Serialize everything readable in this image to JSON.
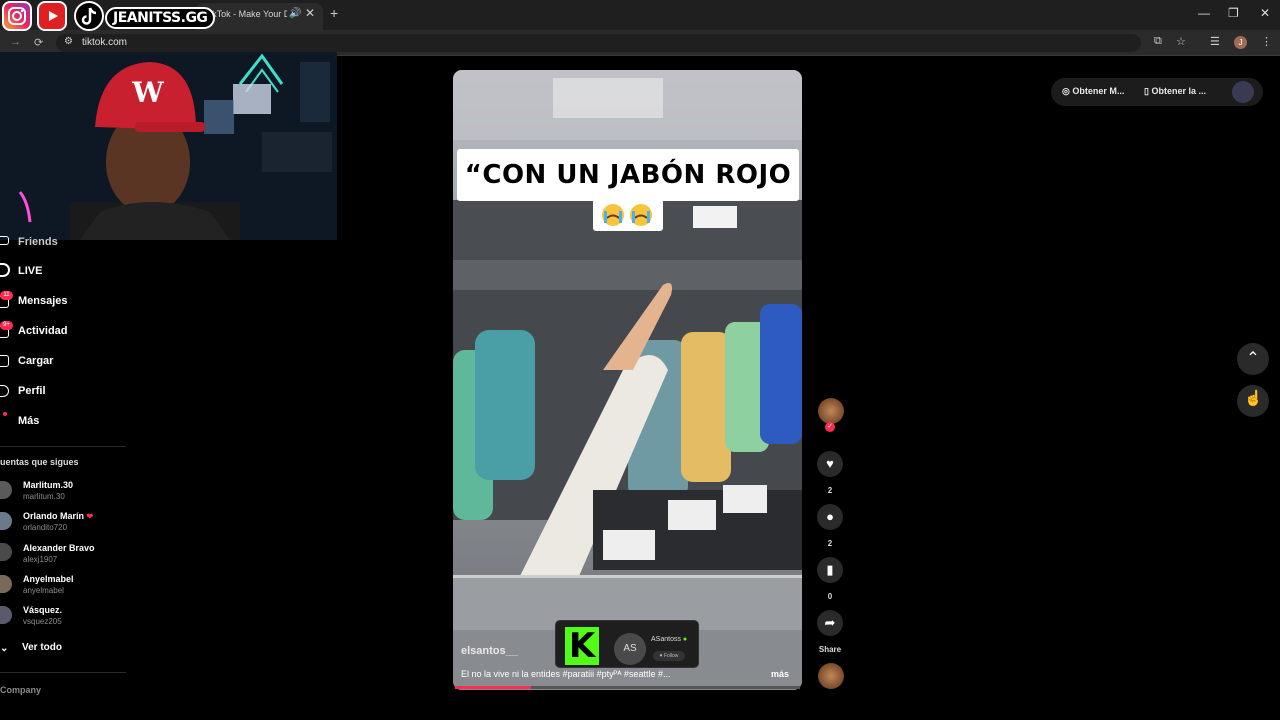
{
  "browser": {
    "tab_title": "TikTok - Make Your Day",
    "tab_audio_icon": "speaker-icon",
    "tab_close": "✕",
    "new_tab": "+",
    "url": "tiktok.com",
    "window_min": "—",
    "window_max": "❐",
    "window_close": "✕",
    "profile_initial": "J"
  },
  "overlay": {
    "badge": "JEANITSS.GG"
  },
  "sidebar": {
    "items": [
      {
        "label": "Friends",
        "icon": "friends-icon"
      },
      {
        "label": "LIVE",
        "icon": "live-icon"
      },
      {
        "label": "Mensajes",
        "icon": "messages-icon",
        "badge": "11"
      },
      {
        "label": "Actividad",
        "icon": "activity-icon",
        "badge": "9+"
      },
      {
        "label": "Cargar",
        "icon": "upload-icon"
      },
      {
        "label": "Perfil",
        "icon": "profile-icon"
      },
      {
        "label": "Más",
        "icon": "more-icon"
      }
    ],
    "following_heading": "uentas que sigues",
    "accounts": [
      {
        "name": "Marlitum.30",
        "user": "marlitum.30"
      },
      {
        "name": "Orlando Marín",
        "user": "orlandito720",
        "emoji": "❤"
      },
      {
        "name": "Alexander Bravo",
        "user": "alexj1907"
      },
      {
        "name": "Anyelmabel",
        "user": "anyelmabel"
      },
      {
        "name": "Vásquez.",
        "user": "vsquez205"
      }
    ],
    "see_all": "Ver todo",
    "company": "Company"
  },
  "video": {
    "caption": "“CON UN JABÓN ROJO “",
    "emoji": "😭😭",
    "author": "elsantos__",
    "description": "El no la vive ni la entides #paratiii #ptyᴾᴬ #seattle #...",
    "more": "más",
    "progress": 0.22,
    "sponsor": {
      "logo": "K",
      "avatar": "AS",
      "name": "ASantoss",
      "follow": "♥ Follow"
    }
  },
  "actions": {
    "like_count": "2",
    "comment_count": "2",
    "save_count": "0",
    "share_label": "Share"
  },
  "top": {
    "btn1": "Obtener M...",
    "btn2": "Obtener la ..."
  },
  "colors": {
    "accent": "#fe2c55",
    "kick_green": "#53fc18",
    "background": "#000000"
  }
}
